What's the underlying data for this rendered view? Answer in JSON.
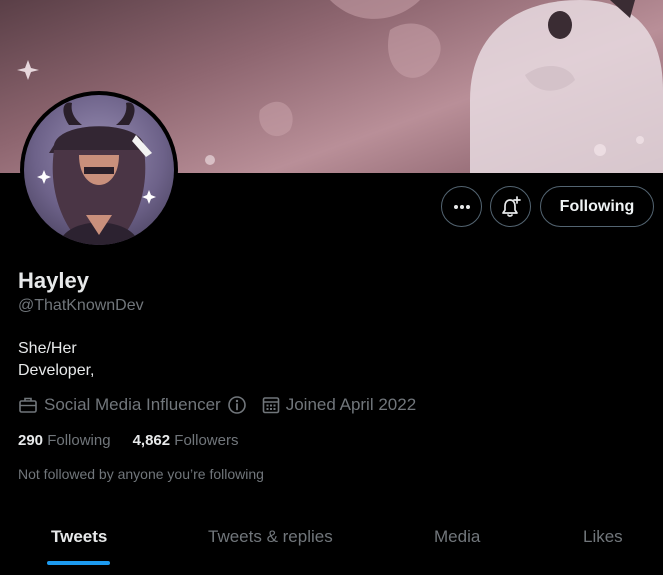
{
  "profile": {
    "name": "Hayley",
    "handle": "@ThatKnownDev",
    "bio_line1": "She/Her",
    "bio_line2": "Developer,",
    "category": "Social Media Influencer",
    "joined": "Joined April 2022",
    "following_count": "290",
    "following_label": "Following",
    "followers_count": "4,862",
    "followers_label": "Followers",
    "not_followed_text": "Not followed by anyone you’re following"
  },
  "actions": {
    "more_icon": "more-icon",
    "notify_icon": "bell-plus-icon",
    "follow_label": "Following"
  },
  "tabs": [
    {
      "label": "Tweets",
      "active": true
    },
    {
      "label": "Tweets & replies",
      "active": false
    },
    {
      "label": "Media",
      "active": false
    },
    {
      "label": "Likes",
      "active": false
    }
  ],
  "colors": {
    "background": "#000000",
    "text_primary": "#e7e9ea",
    "text_secondary": "#71767b",
    "accent": "#1d9bf0",
    "border": "#536471"
  }
}
